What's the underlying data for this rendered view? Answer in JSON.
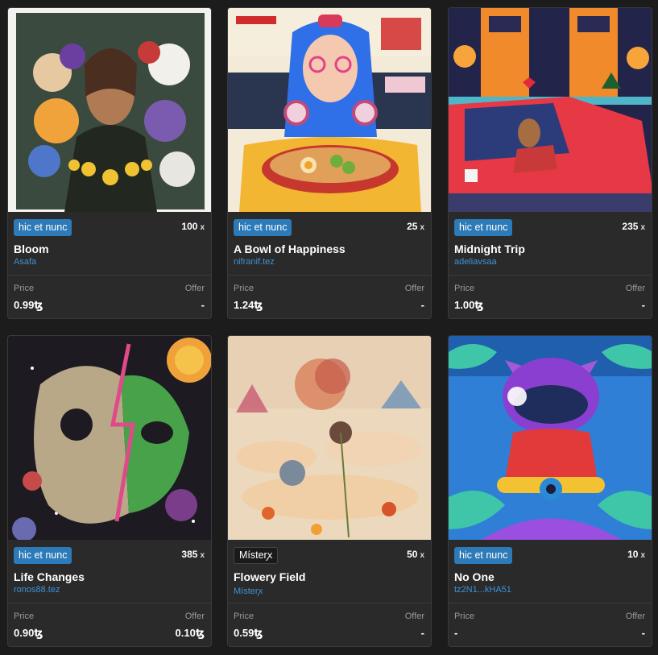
{
  "labels": {
    "price": "Price",
    "offer": "Offer",
    "edition_suffix": "x",
    "currency": "ꜩ"
  },
  "colors": {
    "background": "#1c1c1c",
    "card": "#2a2a2a",
    "platform_badge": "#2c7ab8",
    "creator_link": "#3d93d8"
  },
  "cards": [
    {
      "art_icon": "portrait-with-flowers-art",
      "platform": "hic et nunc",
      "editions": "100",
      "title": "Bloom",
      "creator": "Asafa",
      "price": "0.99ꜩ",
      "offer": "-"
    },
    {
      "art_icon": "ramen-girl-art",
      "platform": "hic et nunc",
      "editions": "25",
      "title": "A Bowl of Happiness",
      "creator": "nifranif.tez",
      "price": "1.24ꜩ",
      "offer": "-"
    },
    {
      "art_icon": "car-night-city-art",
      "platform": "hic et nunc",
      "editions": "235",
      "title": "Midnight Trip",
      "creator": "adeliavsaa",
      "price": "1.00ꜩ",
      "offer": "-"
    },
    {
      "art_icon": "skull-alien-art",
      "platform": "hic et nunc",
      "editions": "385",
      "title": "Life Changes",
      "creator": "ronos88.tez",
      "price": "0.90ꜩ",
      "offer": "0.10ꜩ"
    },
    {
      "art_icon": "flower-field-art",
      "platform": "Místerꭗ",
      "editions": "50",
      "title": "Flowery Field",
      "creator": "Místerꭗ",
      "price": "0.59ꜩ",
      "offer": "-"
    },
    {
      "art_icon": "robot-cat-scooter-art",
      "platform": "hic et nunc",
      "editions": "10",
      "title": "No One",
      "creator": "tz2N1...kHA51",
      "price": "-",
      "offer": "-"
    }
  ]
}
